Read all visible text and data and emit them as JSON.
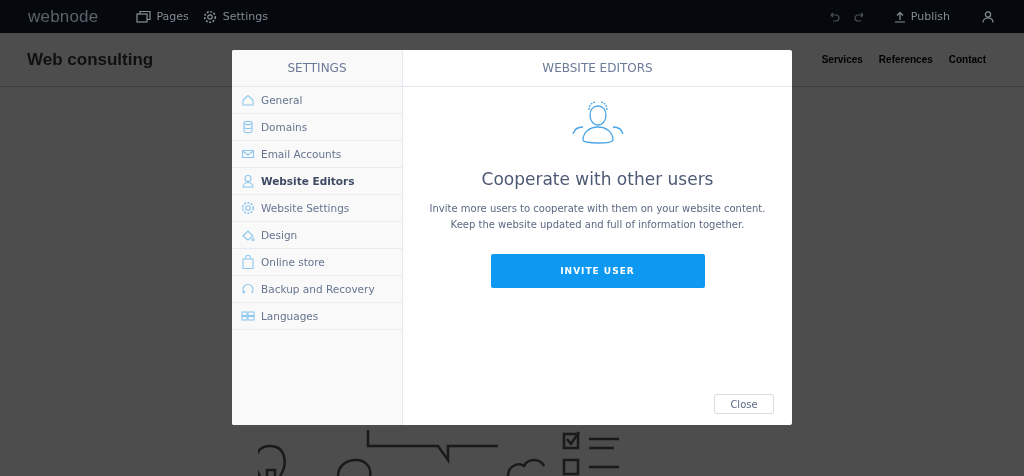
{
  "topbar": {
    "logo": "webnode",
    "menu": [
      {
        "label": "Pages"
      },
      {
        "label": "Settings"
      }
    ],
    "publish": "Publish"
  },
  "site": {
    "title": "Web consulting",
    "nav": [
      "Services",
      "References",
      "Contact"
    ]
  },
  "dialog": {
    "sidebar": {
      "title": "SETTINGS",
      "items": [
        {
          "label": "General",
          "selected": false
        },
        {
          "label": "Domains",
          "selected": false
        },
        {
          "label": "Email Accounts",
          "selected": false
        },
        {
          "label": "Website Editors",
          "selected": true
        },
        {
          "label": "Website Settings",
          "selected": false
        },
        {
          "label": "Design",
          "selected": false
        },
        {
          "label": "Online store",
          "selected": false
        },
        {
          "label": "Backup and Recovery",
          "selected": false
        },
        {
          "label": "Languages",
          "selected": false
        }
      ]
    },
    "title": "WEBSITE EDITORS",
    "heading": "Cooperate with other users",
    "description": [
      "Invite more users to cooperate with them on your website content.",
      "Keep the website updated and full of information together."
    ],
    "primary_button": "INVITE USER",
    "close_button": "Close"
  }
}
